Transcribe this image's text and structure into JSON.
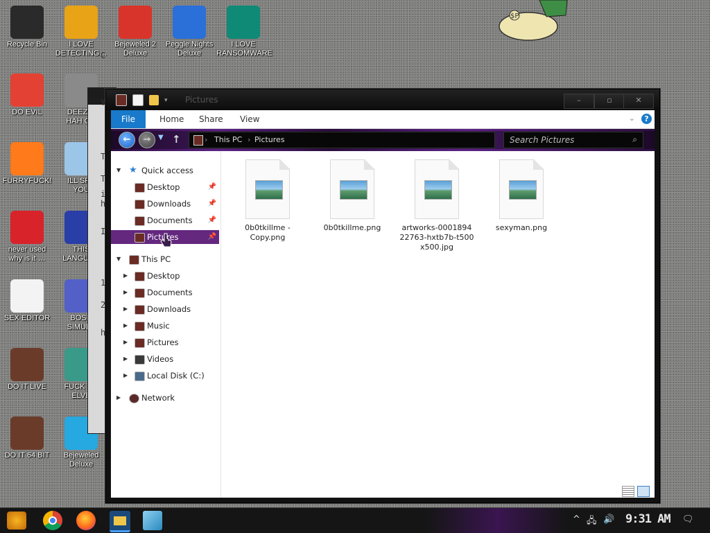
{
  "desktop": {
    "icons": [
      {
        "label": "Recycle Bin",
        "icon": "recycle-bin-icon",
        "color": "#2a2a2a"
      },
      {
        "label": "I LOVE\nDETECTING…",
        "icon": "detect-it-easy-icon",
        "color": "#e8a317"
      },
      {
        "label": "Bejeweled 2\nDeluxe",
        "icon": "bejeweled-2-icon",
        "color": "#d9342b"
      },
      {
        "label": "Peggle Nights\nDeluxe",
        "icon": "peggle-nights-icon",
        "color": "#2b6fd9"
      },
      {
        "label": "I LOVE\nRANSOMWARE",
        "icon": "publisher-icon",
        "color": "#0e8a76"
      },
      {
        "label": "DO EVIL",
        "icon": "chrome-icon",
        "color": "#e34133"
      },
      {
        "label": "DEEZ N\nHAH GO",
        "icon": "copy-icon",
        "color": "#8a8a8a"
      },
      {
        "label": "FURRYFUCK!",
        "icon": "firefox-icon",
        "color": "#ff7a1a"
      },
      {
        "label": "ILL SPY\nYOU",
        "icon": "spy-icon",
        "color": "#9cc6e8"
      },
      {
        "label": "never used\nwhy is it …",
        "icon": "dev-cpp-icon",
        "color": "#d8232a"
      },
      {
        "label": "THIS\nLANGUAG",
        "icon": "go-icon",
        "color": "#2a3ea8"
      },
      {
        "label": "SEX EDITOR",
        "icon": "hxd-icon",
        "color": "#f3f3f3"
      },
      {
        "label": "BOSN\nSIMULA",
        "icon": "bosn-icon",
        "color": "#5260c8"
      },
      {
        "label": "DO IT LIVE",
        "icon": "portrait-icon",
        "color": "#6b3b2a"
      },
      {
        "label": "FUCK SO\nELVE",
        "icon": "elves-icon",
        "color": "#3a9a8a"
      },
      {
        "label": "DO IT 64 BIT",
        "icon": "portrait-64-icon",
        "color": "#6b3b2a"
      },
      {
        "label": "Bejeweled\nDeluxe",
        "icon": "gem-icon",
        "color": "#26a8e0"
      }
    ],
    "wallpaper_sticker": "money-bag-icon"
  },
  "background_window": {
    "visible_text": [
      "C",
      "Y",
      "T",
      "T",
      "i",
      "h",
      "I",
      "1",
      "2",
      "h"
    ]
  },
  "explorer": {
    "title": "Pictures",
    "ribbon_tabs": [
      "File",
      "Home",
      "Share",
      "View"
    ],
    "address": {
      "crumbs": [
        "This PC",
        "Pictures"
      ]
    },
    "search_placeholder": "Search Pictures",
    "nav": {
      "quick_access": {
        "label": "Quick access",
        "items": [
          {
            "label": "Desktop",
            "pinned": true
          },
          {
            "label": "Downloads",
            "pinned": true
          },
          {
            "label": "Documents",
            "pinned": true
          },
          {
            "label": "Pictures",
            "pinned": true,
            "selected": true
          }
        ]
      },
      "this_pc": {
        "label": "This PC",
        "items": [
          {
            "label": "Desktop"
          },
          {
            "label": "Documents"
          },
          {
            "label": "Downloads"
          },
          {
            "label": "Music"
          },
          {
            "label": "Pictures"
          },
          {
            "label": "Videos"
          },
          {
            "label": "Local Disk (C:)"
          }
        ]
      },
      "network": {
        "label": "Network"
      }
    },
    "files": [
      {
        "name": "0b0tkillme -\nCopy.png",
        "type": "png"
      },
      {
        "name": "0b0tkillme.png",
        "type": "png"
      },
      {
        "name": "artworks-0001894\n22763-hxtb7b-t500\nx500.jpg",
        "type": "jpg"
      },
      {
        "name": "sexyman.png",
        "type": "png"
      }
    ],
    "accent_color": "#64287f",
    "file_tab_color": "#1979ca"
  },
  "taskbar": {
    "apps": [
      "start-icon",
      "chrome-icon",
      "firefox-icon",
      "file-explorer-icon",
      "notepad-icon"
    ],
    "clock": "9:31 AM"
  }
}
